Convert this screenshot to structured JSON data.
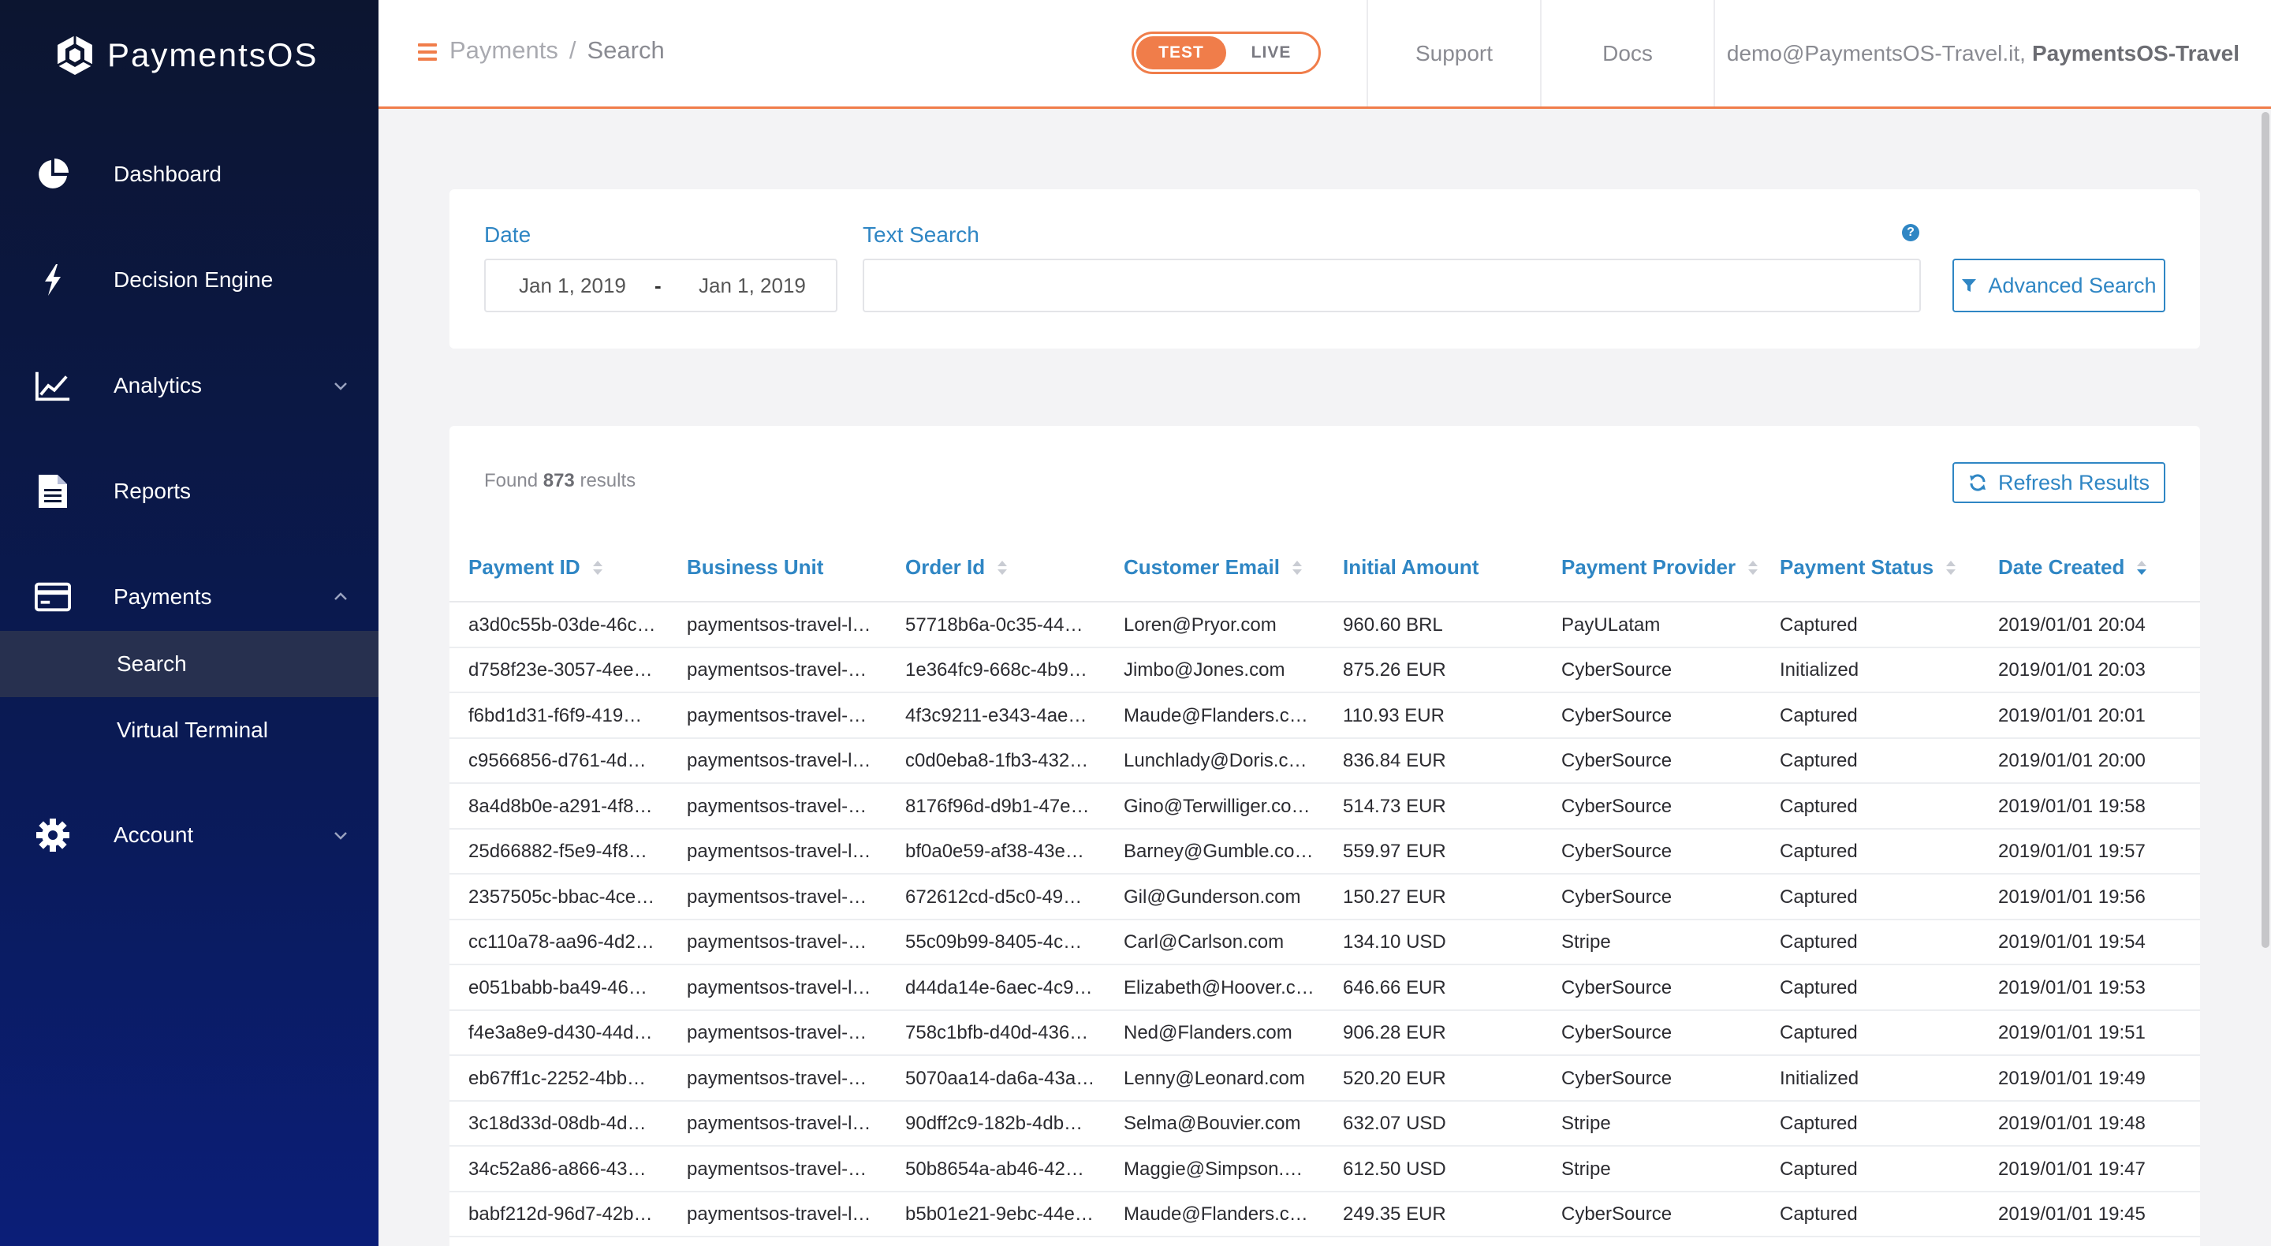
{
  "app": {
    "name": "PaymentsOS"
  },
  "sidebar": {
    "items": [
      {
        "label": "Dashboard",
        "icon": "pie-chart-icon"
      },
      {
        "label": "Decision Engine",
        "icon": "bolt-icon"
      },
      {
        "label": "Analytics",
        "icon": "line-chart-icon"
      },
      {
        "label": "Reports",
        "icon": "document-icon"
      },
      {
        "label": "Payments",
        "icon": "credit-card-icon"
      },
      {
        "label": "Account",
        "icon": "gear-icon"
      }
    ],
    "payments_sub": [
      {
        "label": "Search",
        "active": true
      },
      {
        "label": "Virtual Terminal",
        "active": false
      }
    ]
  },
  "topbar": {
    "breadcrumb": [
      "Payments",
      "Search"
    ],
    "env_toggle": {
      "test": "TEST",
      "live": "LIVE",
      "selected": "TEST"
    },
    "support": "Support",
    "docs": "Docs",
    "user_email": "demo@PaymentsOS-Travel.it,",
    "account_name": "PaymentsOS-Travel"
  },
  "search": {
    "date_label": "Date",
    "date_from": "Jan 1, 2019",
    "date_sep": "-",
    "date_to": "Jan 1, 2019",
    "text_label": "Text Search",
    "text_value": "",
    "help": "?",
    "advanced_button": "Advanced Search"
  },
  "results": {
    "found_prefix": "Found",
    "count": "873",
    "found_suffix": "results",
    "refresh_button": "Refresh Results",
    "columns": [
      "Payment ID",
      "Business Unit",
      "Order Id",
      "Customer Email",
      "Initial Amount",
      "Payment Provider",
      "Payment Status",
      "Date Created"
    ],
    "rows": [
      [
        "a3d0c55b-03de-46c…",
        "paymentsos-travel-l…",
        "57718b6a-0c35-44…",
        "Loren@Pryor.com",
        "960.60 BRL",
        "PayULatam",
        "Captured",
        "2019/01/01 20:04"
      ],
      [
        "d758f23e-3057-4ee…",
        "paymentsos-travel-…",
        "1e364fc9-668c-4b9…",
        "Jimbo@Jones.com",
        "875.26 EUR",
        "CyberSource",
        "Initialized",
        "2019/01/01 20:03"
      ],
      [
        "f6bd1d31-f6f9-419…",
        "paymentsos-travel-…",
        "4f3c9211-e343-4ae…",
        "Maude@Flanders.c…",
        "110.93 EUR",
        "CyberSource",
        "Captured",
        "2019/01/01 20:01"
      ],
      [
        "c9566856-d761-4d…",
        "paymentsos-travel-l…",
        "c0d0eba8-1fb3-432…",
        "Lunchlady@Doris.c…",
        "836.84 EUR",
        "CyberSource",
        "Captured",
        "2019/01/01 20:00"
      ],
      [
        "8a4d8b0e-a291-4f8…",
        "paymentsos-travel-…",
        "8176f96d-d9b1-47e…",
        "Gino@Terwilliger.co…",
        "514.73 EUR",
        "CyberSource",
        "Captured",
        "2019/01/01 19:58"
      ],
      [
        "25d66882-f5e9-4f8…",
        "paymentsos-travel-l…",
        "bf0a0e59-af38-43e…",
        "Barney@Gumble.co…",
        "559.97 EUR",
        "CyberSource",
        "Captured",
        "2019/01/01 19:57"
      ],
      [
        "2357505c-bbac-4ce…",
        "paymentsos-travel-…",
        "672612cd-d5c0-49…",
        "Gil@Gunderson.com",
        "150.27 EUR",
        "CyberSource",
        "Captured",
        "2019/01/01 19:56"
      ],
      [
        "cc110a78-aa96-4d2…",
        "paymentsos-travel-…",
        "55c09b99-8405-4c…",
        "Carl@Carlson.com",
        "134.10 USD",
        "Stripe",
        "Captured",
        "2019/01/01 19:54"
      ],
      [
        "e051babb-ba49-46…",
        "paymentsos-travel-l…",
        "d44da14e-6aec-4c9…",
        "Elizabeth@Hoover.c…",
        "646.66 EUR",
        "CyberSource",
        "Captured",
        "2019/01/01 19:53"
      ],
      [
        "f4e3a8e9-d430-44d…",
        "paymentsos-travel-…",
        "758c1bfb-d40d-436…",
        "Ned@Flanders.com",
        "906.28 EUR",
        "CyberSource",
        "Captured",
        "2019/01/01 19:51"
      ],
      [
        "eb67ff1c-2252-4bb…",
        "paymentsos-travel-…",
        "5070aa14-da6a-43a…",
        "Lenny@Leonard.com",
        "520.20 EUR",
        "CyberSource",
        "Initialized",
        "2019/01/01 19:49"
      ],
      [
        "3c18d33d-08db-4d…",
        "paymentsos-travel-l…",
        "90dff2c9-182b-4db…",
        "Selma@Bouvier.com",
        "632.07 USD",
        "Stripe",
        "Captured",
        "2019/01/01 19:48"
      ],
      [
        "34c52a86-a866-43…",
        "paymentsos-travel-…",
        "50b8654a-ab46-42…",
        "Maggie@Simpson.…",
        "612.50 USD",
        "Stripe",
        "Captured",
        "2019/01/01 19:47"
      ],
      [
        "babf212d-96d7-42b…",
        "paymentsos-travel-l…",
        "b5b01e21-9ebc-44e…",
        "Maude@Flanders.c…",
        "249.35 EUR",
        "CyberSource",
        "Captured",
        "2019/01/01 19:45"
      ]
    ]
  },
  "colors": {
    "accent": "#f07d4a",
    "link": "#2f86c4",
    "sidebar_top": "#0c1530",
    "sidebar_bottom": "#0b1e78"
  }
}
